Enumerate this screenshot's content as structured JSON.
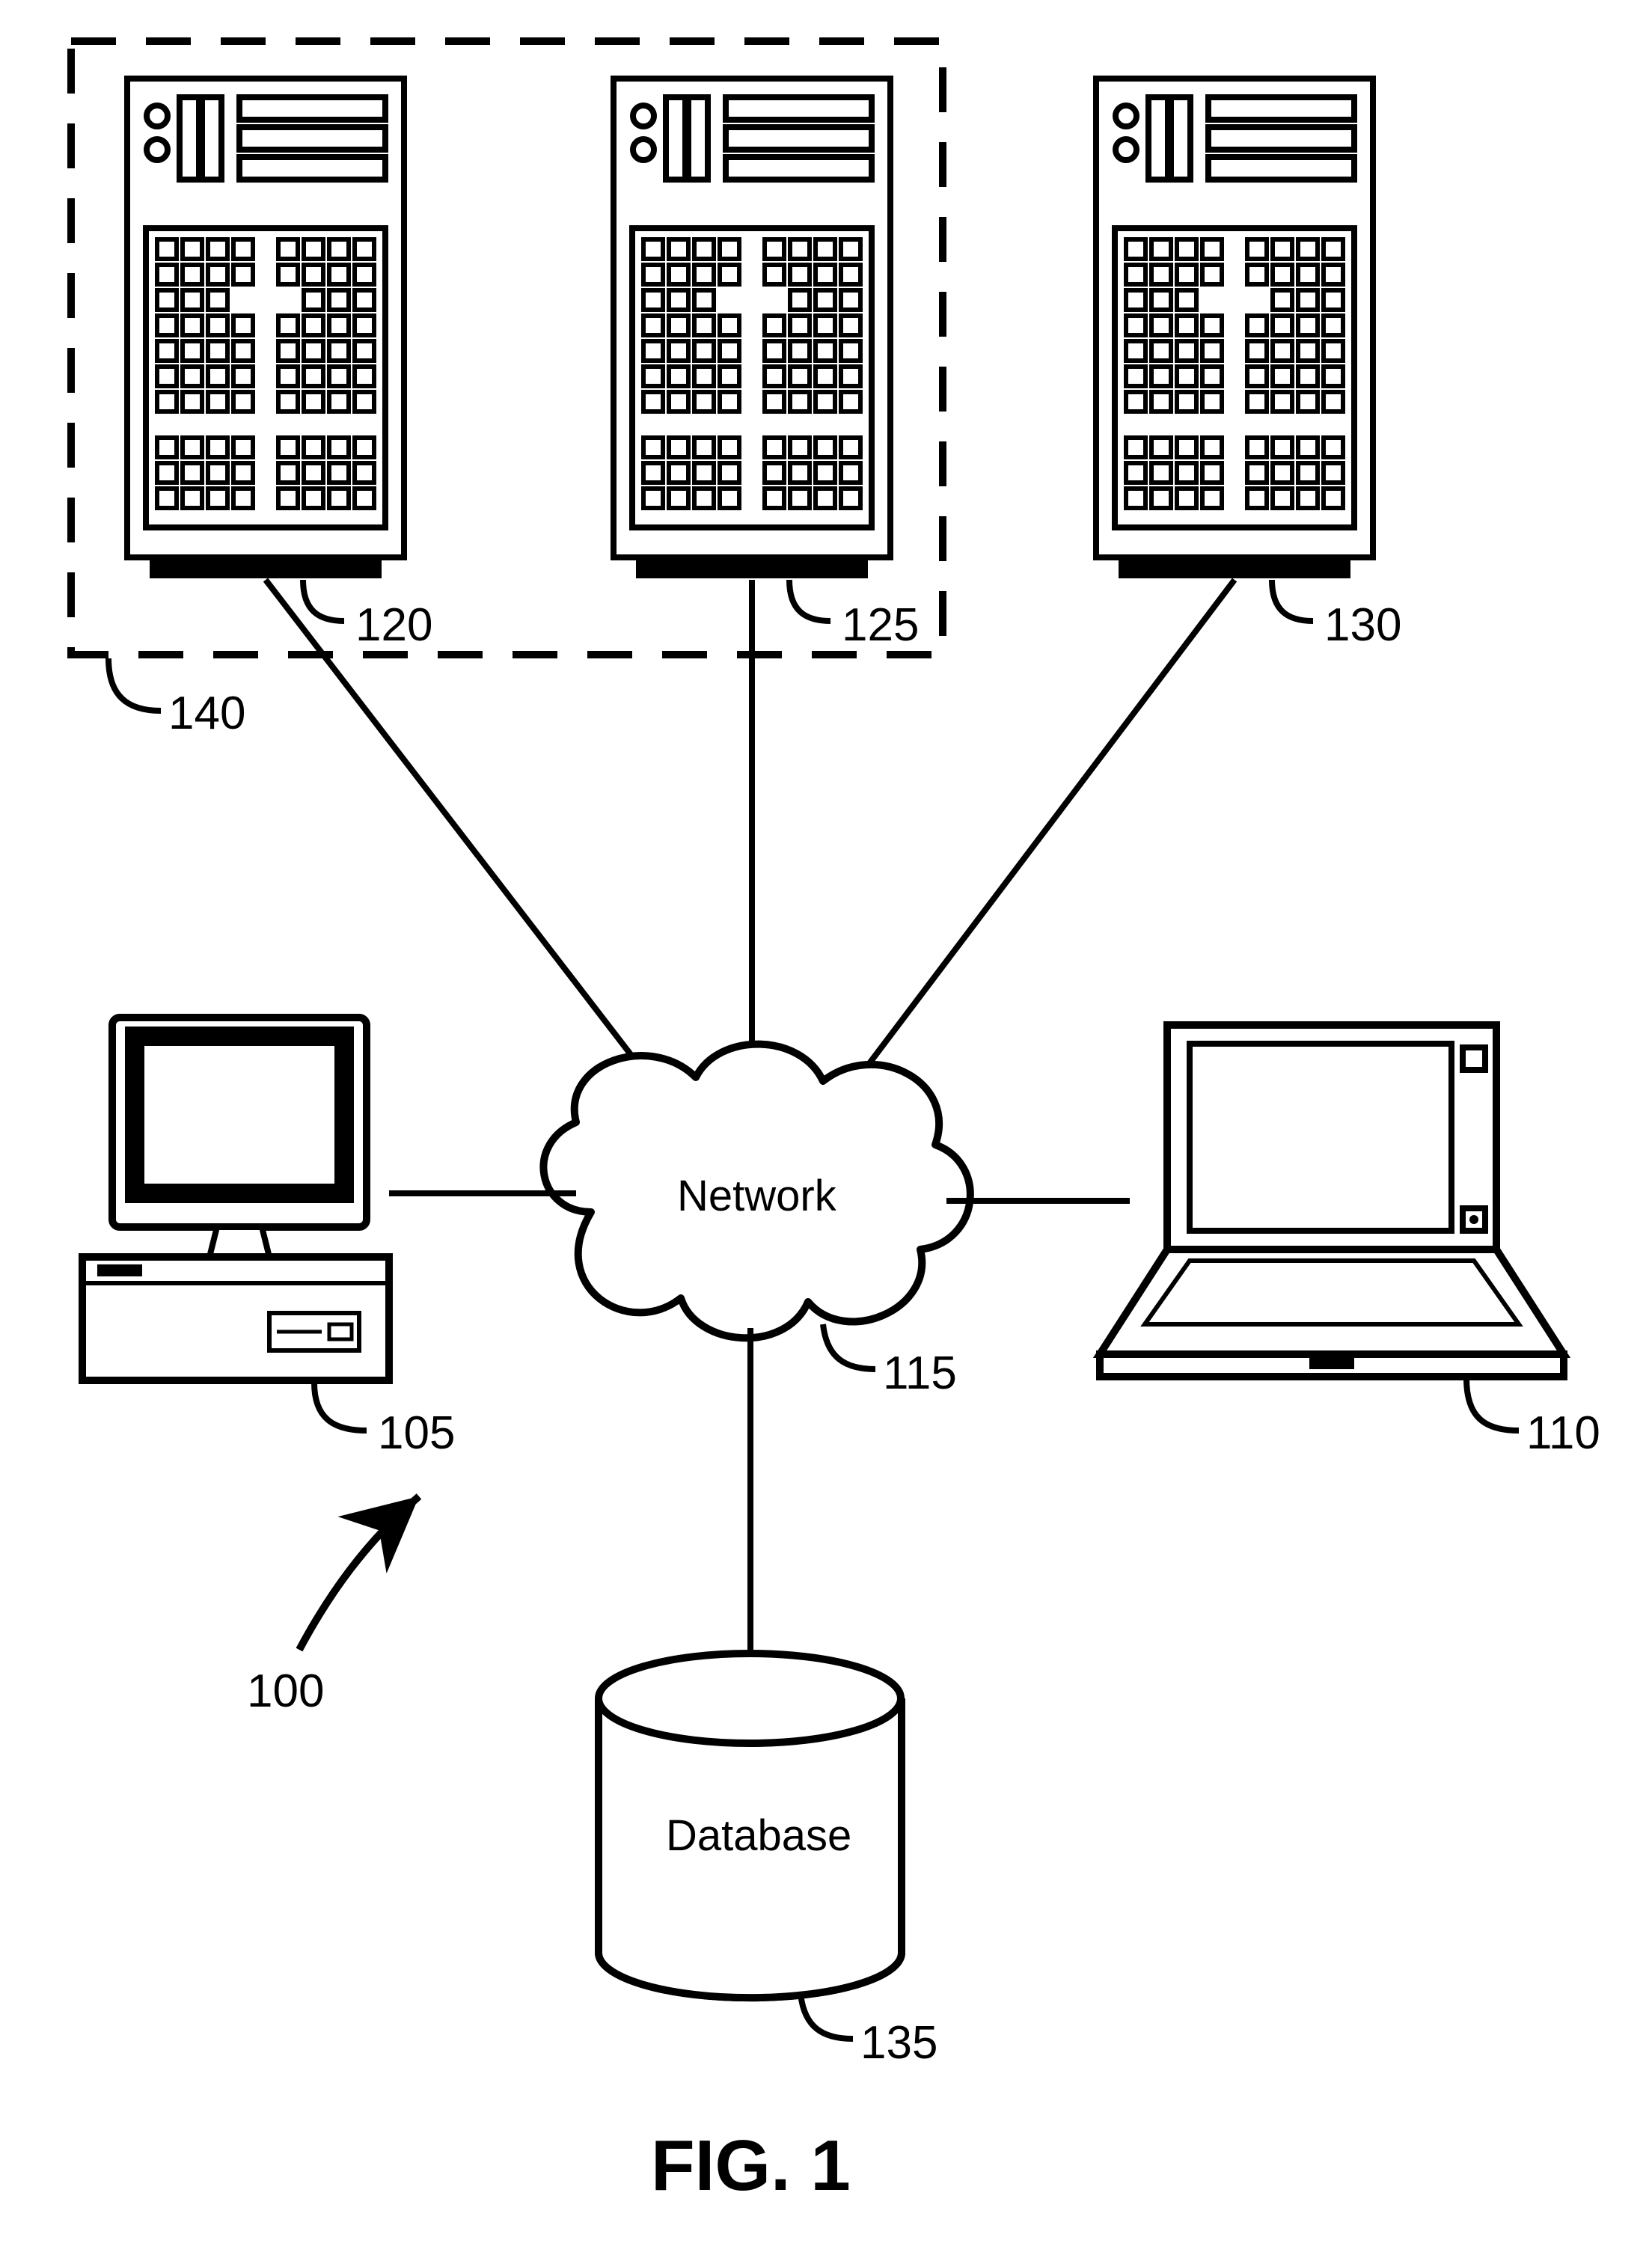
{
  "figure_label": "FIG. 1",
  "network_label": "Network",
  "database_label": "Database",
  "refs": {
    "system": "100",
    "desktop": "105",
    "laptop": "110",
    "network": "115",
    "server_left": "120",
    "server_mid": "125",
    "server_right": "130",
    "database": "135",
    "server_group": "140"
  }
}
